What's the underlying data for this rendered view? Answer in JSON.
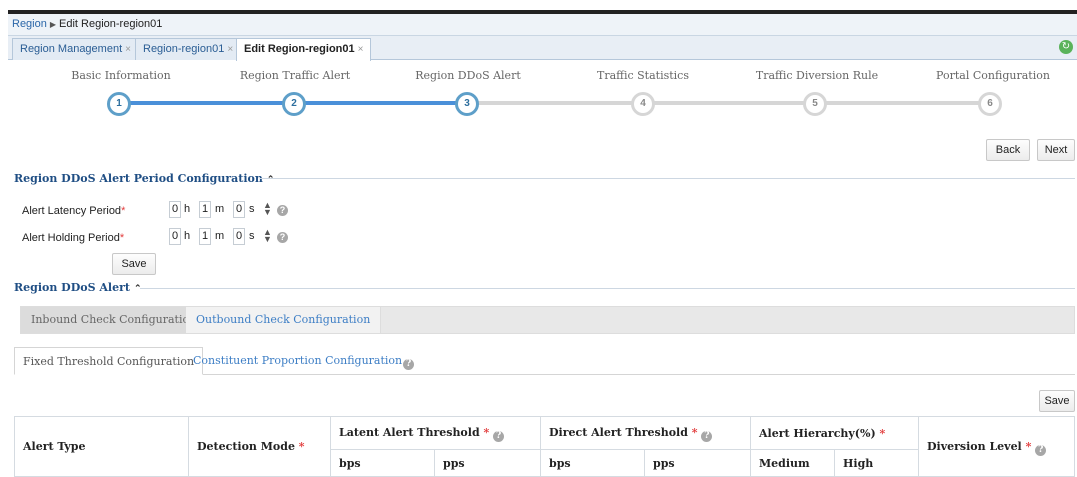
{
  "breadcrumb": {
    "root": "Region",
    "current": "Edit Region-region01"
  },
  "tabs": [
    {
      "label": "Region Management",
      "close": "×"
    },
    {
      "label": "Region-region01",
      "close": "×"
    },
    {
      "label": "Edit Region-region01",
      "close": "×"
    }
  ],
  "steps": [
    {
      "label": "Basic Information",
      "num": "1"
    },
    {
      "label": "Region Traffic Alert",
      "num": "2"
    },
    {
      "label": "Region DDoS Alert",
      "num": "3"
    },
    {
      "label": "Traffic Statistics",
      "num": "4"
    },
    {
      "label": "Traffic Diversion Rule",
      "num": "5"
    },
    {
      "label": "Portal Configuration",
      "num": "6"
    }
  ],
  "current_step": 3,
  "nav": {
    "back": "Back",
    "next": "Next"
  },
  "period": {
    "title": "Region DDoS Alert Period Configuration",
    "latency_label": "Alert Latency Period",
    "holding_label": "Alert Holding Period",
    "latency": {
      "h": "0",
      "m": "1",
      "s": "0"
    },
    "holding": {
      "h": "0",
      "m": "1",
      "s": "0"
    },
    "unit_h": "h",
    "unit_m": "m",
    "unit_s": "s",
    "save": "Save"
  },
  "alert": {
    "title": "Region DDoS Alert",
    "check_tabs": [
      "Inbound Check Configuration",
      "Outbound Check Configuration"
    ],
    "sub_tabs": [
      "Fixed Threshold Configuration",
      "Constituent Proportion Configuration"
    ],
    "save": "Save"
  },
  "table": {
    "alert_type": "Alert Type",
    "detection_mode": "Detection Mode",
    "latent": "Latent Alert Threshold",
    "direct": "Direct Alert Threshold",
    "hierarchy": "Alert Hierarchy(%)",
    "diversion": "Diversion Level",
    "bps": "bps",
    "pps": "pps",
    "medium": "Medium",
    "high": "High"
  },
  "colors": {
    "accent": "#4a90d9",
    "title": "#1f4e84",
    "required": "#e23b3b"
  }
}
